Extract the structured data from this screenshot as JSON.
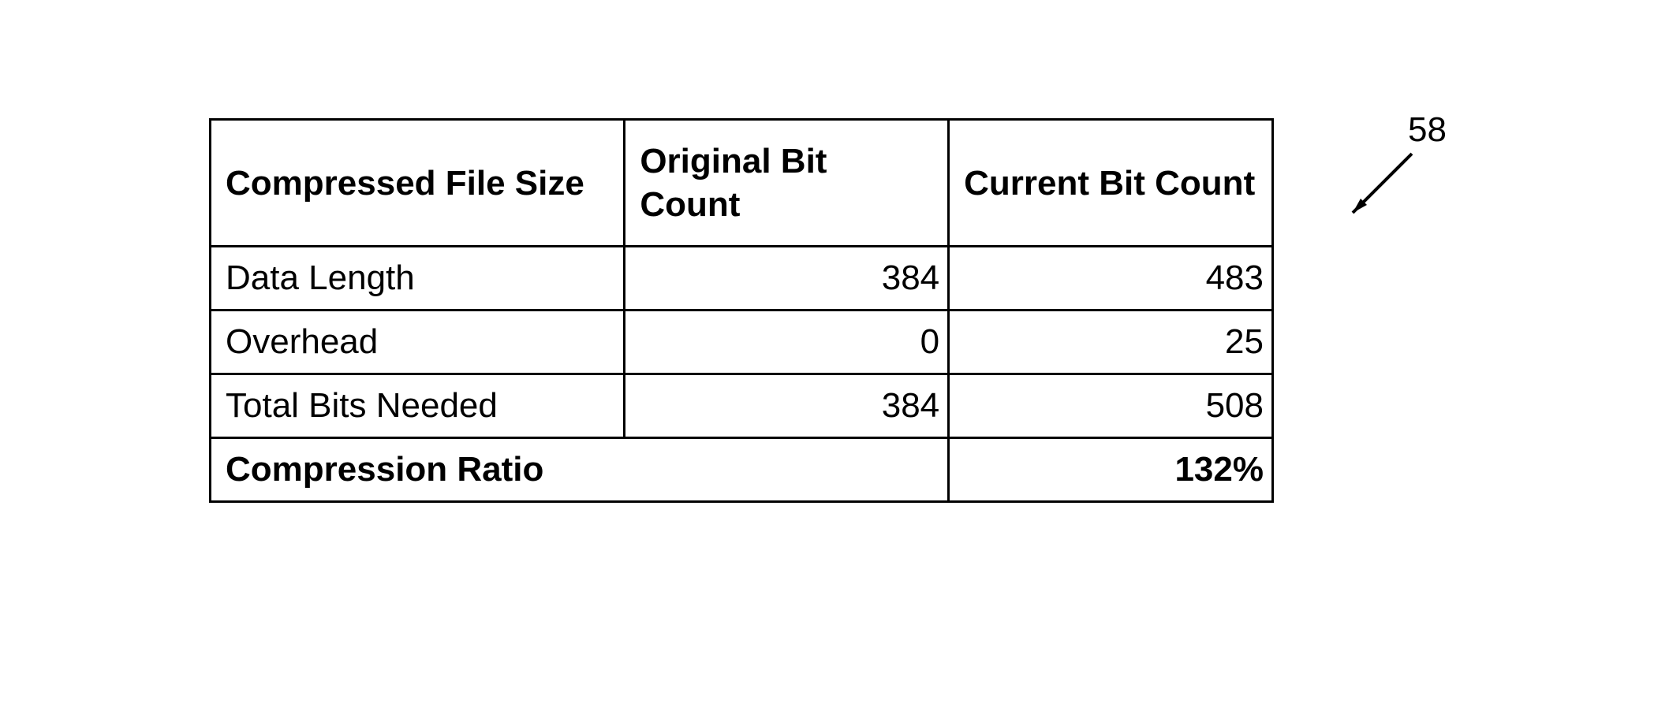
{
  "chart_data": {
    "type": "table",
    "headers": [
      "Compressed File Size",
      "Original Bit Count",
      "Current Bit Count"
    ],
    "rows": [
      {
        "label": "Data Length",
        "original": 384,
        "current": 483
      },
      {
        "label": "Overhead",
        "original": 0,
        "current": 25
      },
      {
        "label": "Total Bits Needed",
        "original": 384,
        "current": 508
      }
    ],
    "compression_ratio_label": "Compression Ratio",
    "compression_ratio": "132%"
  },
  "headers": {
    "col1": "Compressed File Size",
    "col2": "Original Bit Count",
    "col3": "Current Bit Count"
  },
  "rows": [
    {
      "label": "Data Length",
      "orig": "384",
      "curr": "483"
    },
    {
      "label": "Overhead",
      "orig": "0",
      "curr": "25"
    },
    {
      "label": "Total Bits Needed",
      "orig": "384",
      "curr": "508"
    }
  ],
  "ratio": {
    "label": "Compression Ratio",
    "value": "132%"
  },
  "callout": {
    "number": "58"
  }
}
